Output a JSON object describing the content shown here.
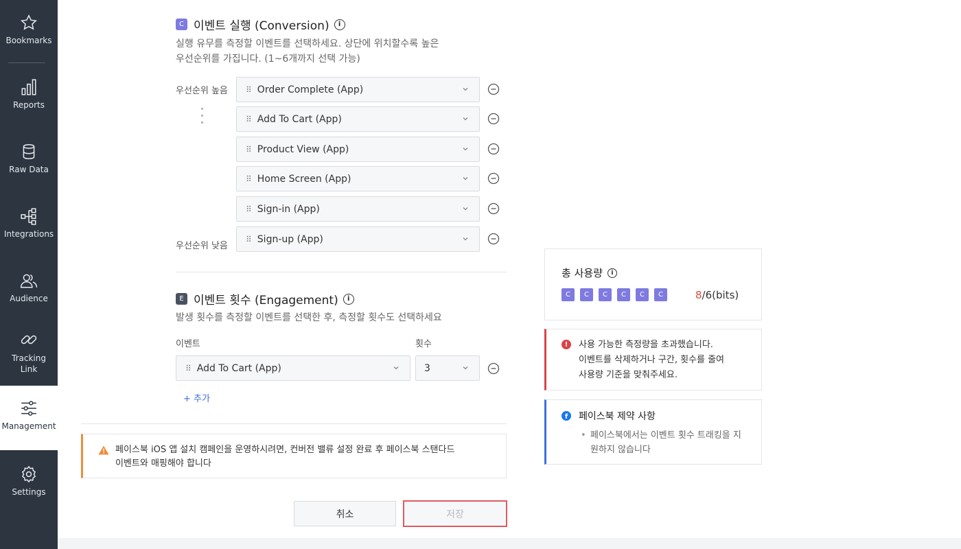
{
  "sidebar": {
    "items": [
      {
        "label": "Bookmarks",
        "icon": "star-icon"
      },
      {
        "label": "Reports",
        "icon": "bar-chart-icon"
      },
      {
        "label": "Raw Data",
        "icon": "database-icon"
      },
      {
        "label": "Integrations",
        "icon": "integrations-icon"
      },
      {
        "label": "Audience",
        "icon": "audience-icon"
      },
      {
        "label": "Tracking Link",
        "icon": "link-icon"
      },
      {
        "label": "Management",
        "icon": "sliders-icon",
        "active": true
      },
      {
        "label": "Settings",
        "icon": "gear-icon"
      }
    ]
  },
  "conversion": {
    "badge": "C",
    "title": "이벤트 실행 (Conversion)",
    "desc_line1": "실행 유무를 측정할 이벤트를 선택하세요. 상단에 위치할수록 높은",
    "desc_line2": "우선순위를 가집니다. (1~6개까지 선택 가능)",
    "priority_high": "우선순위 높음",
    "priority_low": "우선순위 낮음",
    "events": [
      "Order Complete (App)",
      "Add To Cart (App)",
      "Product View (App)",
      "Home Screen (App)",
      "Sign-in (App)",
      "Sign-up (App)"
    ]
  },
  "engagement": {
    "badge": "E",
    "title": "이벤트 횟수 (Engagement)",
    "desc": "발생 횟수를 측정할 이벤트를 선택한 후, 측정할 횟수도 선택하세요",
    "event_label": "이벤트",
    "count_label": "횟수",
    "event_value": "Add To Cart (App)",
    "count_value": "3",
    "add_label": "+ 추가"
  },
  "warning": {
    "line1": "페이스북 iOS 앱 설치 캠페인을 운영하시려면, 컨버전 밸류 설정 완료 후 페이스북 스탠다드",
    "line2": "이벤트와 매핑해야 합니다"
  },
  "buttons": {
    "cancel": "취소",
    "save": "저장"
  },
  "usage": {
    "title": "총 사용량",
    "chips": [
      "C",
      "C",
      "C",
      "C",
      "C",
      "C"
    ],
    "used": "8",
    "total": "/6(bits)"
  },
  "error_alert": {
    "line1": "사용 가능한 측정량을 초과했습니다.",
    "line2": "이벤트를 삭제하거나 구간, 횟수를 줄여",
    "line3": "사용량 기준을 맞춰주세요."
  },
  "fb_alert": {
    "title": "페이스북 제약 사항",
    "item": "페이스북에서는 이벤트 횟수 트래킹을 지원하지 않습니다"
  },
  "colors": {
    "sidebar": "#2c3540",
    "accent_purple": "#7e7ae0",
    "error": "#d9434a",
    "warning": "#f08c3c",
    "info": "#3d6fe0"
  }
}
